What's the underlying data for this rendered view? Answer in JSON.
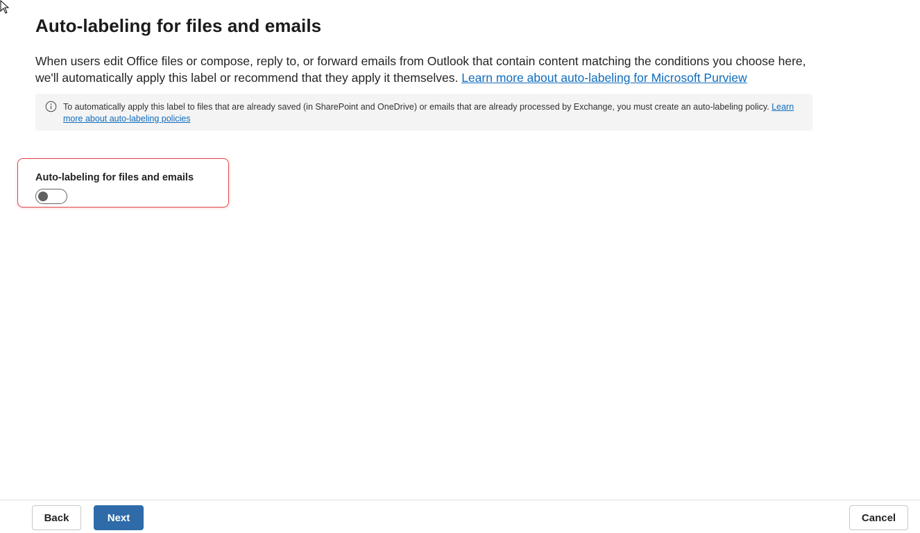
{
  "page": {
    "title": "Auto-labeling for files and emails",
    "description": "When users edit Office files or compose, reply to, or forward emails from Outlook that contain content matching the conditions you choose here, we'll automatically apply this label or recommend that they apply it themselves.",
    "description_link": "Learn more about auto-labeling for Microsoft Purview"
  },
  "info": {
    "icon": "info-icon",
    "text": "To automatically apply this label to files that are already saved (in SharePoint and OneDrive) or emails that are already processed by Exchange, you must create an auto-labeling policy.",
    "link": "Learn more about auto-labeling policies"
  },
  "toggle": {
    "label": "Auto-labeling for files and emails",
    "state": "off"
  },
  "footer": {
    "back_label": "Back",
    "next_label": "Next",
    "cancel_label": "Cancel"
  },
  "colors": {
    "primary": "#2f6ba9",
    "link": "#0f6cbd",
    "highlight_border": "#e0454a",
    "info_background": "#f4f4f4"
  }
}
